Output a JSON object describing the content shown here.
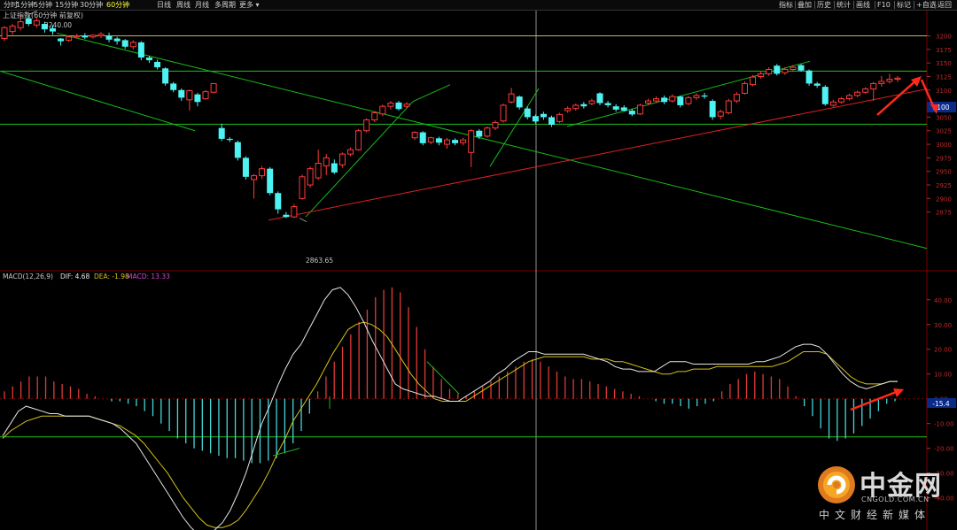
{
  "toolbar": {
    "left_items": [
      "分时",
      "1分钟",
      "5分钟",
      "15分钟",
      "30分钟",
      "60分钟",
      "日线",
      "周线",
      "月线",
      "多周期",
      "更多 ▾"
    ],
    "active": "60分钟",
    "right_items": [
      "指标",
      "叠加",
      "历史",
      "统计",
      "画线",
      "F10",
      "标记",
      "+自选",
      "返回"
    ]
  },
  "colors": {
    "up": "#ff3b3b",
    "down": "#4ef2f2",
    "background": "#000000",
    "grid": "#7a0000",
    "trend_green": "#18b918",
    "trend_red": "#e02020",
    "hline_yellow": "#c8b45a",
    "dif": "#e6e6e6",
    "dea": "#d4c21a",
    "macd_label": "#d24bd2",
    "annotation_red": "#ff2a1a"
  },
  "price_panel": {
    "title": "上证指数(60分钟 前复权)",
    "high_label": "3240.00",
    "low_label": "2863.65",
    "price_tag": "3100"
  },
  "macd_panel": {
    "title": "MACD(12,26,9)",
    "dif_label": "DIF: 4.68",
    "dea_label": "DEA: -1.98",
    "macd_label": "MACD: 13.33",
    "level_tag": "-15.4"
  },
  "chart_data": [
    {
      "type": "candlestick",
      "title": "上证指数(60分钟 前复权)",
      "ylim": [
        2770,
        3240
      ],
      "y_ticks": [
        3200,
        3175,
        3150,
        3125,
        3100,
        3075,
        3050,
        3025,
        3000,
        2975,
        2950,
        2925,
        2900,
        2875
      ],
      "annotations": [
        {
          "text": "3240.00",
          "x": 34,
          "y": 3240
        },
        {
          "text": "2863.65",
          "x": 338,
          "y": 2863.65
        }
      ],
      "horizontal_lines": [
        3200,
        3135,
        3037
      ],
      "trend_lines": [
        {
          "color": "green",
          "from": [
            0,
            3135
          ],
          "to": [
            220,
            3025
          ]
        },
        {
          "color": "green",
          "from": [
            64,
            3205
          ],
          "to": [
            1046,
            2808
          ]
        },
        {
          "color": "green",
          "from": [
            345,
            2866
          ],
          "to": [
            466,
            3079
          ]
        },
        {
          "color": "green",
          "from": [
            466,
            3079
          ],
          "to": [
            508,
            3110
          ]
        },
        {
          "color": "green",
          "from": [
            553,
            2959
          ],
          "to": [
            608,
            3103
          ]
        },
        {
          "color": "green",
          "from": [
            640,
            3033
          ],
          "to": [
            914,
            3153
          ]
        },
        {
          "color": "red",
          "from": [
            303,
            2860
          ],
          "to": [
            1046,
            3102
          ]
        }
      ],
      "candles": [
        {
          "o": 3195,
          "c": 3215,
          "h": 3218,
          "l": 3190
        },
        {
          "o": 3208,
          "c": 3218,
          "h": 3222,
          "l": 3202
        },
        {
          "o": 3215,
          "c": 3226,
          "h": 3240,
          "l": 3210
        },
        {
          "o": 3232,
          "c": 3222,
          "h": 3238,
          "l": 3218
        },
        {
          "o": 3220,
          "c": 3228,
          "h": 3233,
          "l": 3215
        },
        {
          "o": 3222,
          "c": 3212,
          "h": 3226,
          "l": 3206
        },
        {
          "o": 3214,
          "c": 3208,
          "h": 3220,
          "l": 3202
        },
        {
          "o": 3195,
          "c": 3190,
          "h": 3196,
          "l": 3182
        },
        {
          "o": 3192,
          "c": 3198,
          "h": 3201,
          "l": 3189
        },
        {
          "o": 3198,
          "c": 3200,
          "h": 3204,
          "l": 3195
        },
        {
          "o": 3200,
          "c": 3197,
          "h": 3205,
          "l": 3194
        },
        {
          "o": 3198,
          "c": 3201,
          "h": 3203,
          "l": 3195
        },
        {
          "o": 3200,
          "c": 3203,
          "h": 3207,
          "l": 3196
        },
        {
          "o": 3200,
          "c": 3193,
          "h": 3206,
          "l": 3188
        },
        {
          "o": 3195,
          "c": 3190,
          "h": 3198,
          "l": 3184
        },
        {
          "o": 3192,
          "c": 3180,
          "h": 3194,
          "l": 3176
        },
        {
          "o": 3180,
          "c": 3188,
          "h": 3192,
          "l": 3175
        },
        {
          "o": 3188,
          "c": 3160,
          "h": 3190,
          "l": 3155
        },
        {
          "o": 3160,
          "c": 3155,
          "h": 3163,
          "l": 3150
        },
        {
          "o": 3152,
          "c": 3142,
          "h": 3156,
          "l": 3138
        },
        {
          "o": 3140,
          "c": 3112,
          "h": 3142,
          "l": 3108
        },
        {
          "o": 3112,
          "c": 3100,
          "h": 3115,
          "l": 3096
        },
        {
          "o": 3100,
          "c": 3086,
          "h": 3103,
          "l": 3080
        },
        {
          "o": 3082,
          "c": 3099,
          "h": 3101,
          "l": 3062
        },
        {
          "o": 3092,
          "c": 3078,
          "h": 3095,
          "l": 3070
        },
        {
          "o": 3084,
          "c": 3097,
          "h": 3100,
          "l": 3082
        },
        {
          "o": 3096,
          "c": 3112,
          "h": 3113,
          "l": 3094
        },
        {
          "o": 3030,
          "c": 3010,
          "h": 3038,
          "l": 3006
        },
        {
          "o": 3010,
          "c": 3008,
          "h": 3013,
          "l": 3004
        },
        {
          "o": 3004,
          "c": 2975,
          "h": 3007,
          "l": 2970
        },
        {
          "o": 2975,
          "c": 2940,
          "h": 2978,
          "l": 2935
        },
        {
          "o": 2935,
          "c": 2942,
          "h": 2945,
          "l": 2900
        },
        {
          "o": 2942,
          "c": 2955,
          "h": 2960,
          "l": 2936
        },
        {
          "o": 2955,
          "c": 2910,
          "h": 2958,
          "l": 2906
        },
        {
          "o": 2910,
          "c": 2880,
          "h": 2913,
          "l": 2872
        },
        {
          "o": 2870,
          "c": 2866,
          "h": 2875,
          "l": 2864
        },
        {
          "o": 2866,
          "c": 2885,
          "h": 2890,
          "l": 2864
        },
        {
          "o": 2900,
          "c": 2940,
          "h": 2944,
          "l": 2898
        },
        {
          "o": 2925,
          "c": 2955,
          "h": 2959,
          "l": 2920
        },
        {
          "o": 2938,
          "c": 2965,
          "h": 2990,
          "l": 2934
        },
        {
          "o": 2960,
          "c": 2975,
          "h": 2982,
          "l": 2943
        },
        {
          "o": 2965,
          "c": 2948,
          "h": 2972,
          "l": 2945
        },
        {
          "o": 2962,
          "c": 2982,
          "h": 2985,
          "l": 2957
        },
        {
          "o": 2982,
          "c": 2990,
          "h": 2994,
          "l": 2978
        },
        {
          "o": 2990,
          "c": 3025,
          "h": 3028,
          "l": 2988
        },
        {
          "o": 3025,
          "c": 3045,
          "h": 3048,
          "l": 3022
        },
        {
          "o": 3045,
          "c": 3058,
          "h": 3061,
          "l": 3041
        },
        {
          "o": 3056,
          "c": 3070,
          "h": 3073,
          "l": 3052
        },
        {
          "o": 3070,
          "c": 3076,
          "h": 3080,
          "l": 3064
        },
        {
          "o": 3077,
          "c": 3065,
          "h": 3080,
          "l": 3062
        },
        {
          "o": 3070,
          "c": 3074,
          "h": 3078,
          "l": 3066
        },
        {
          "o": 3012,
          "c": 3022,
          "h": 3024,
          "l": 3008
        },
        {
          "o": 3022,
          "c": 3002,
          "h": 3024,
          "l": 2998
        },
        {
          "o": 3004,
          "c": 3012,
          "h": 3014,
          "l": 3000
        },
        {
          "o": 3011,
          "c": 3003,
          "h": 3014,
          "l": 2998
        },
        {
          "o": 3000,
          "c": 3008,
          "h": 3012,
          "l": 2992
        },
        {
          "o": 3008,
          "c": 3002,
          "h": 3011,
          "l": 2998
        },
        {
          "o": 3003,
          "c": 3008,
          "h": 3012,
          "l": 2998
        },
        {
          "o": 2985,
          "c": 3025,
          "h": 3028,
          "l": 2958
        },
        {
          "o": 3025,
          "c": 3014,
          "h": 3028,
          "l": 3010
        },
        {
          "o": 3015,
          "c": 3030,
          "h": 3033,
          "l": 3012
        },
        {
          "o": 3030,
          "c": 3040,
          "h": 3044,
          "l": 3026
        },
        {
          "o": 3043,
          "c": 3072,
          "h": 3075,
          "l": 3040
        },
        {
          "o": 3078,
          "c": 3093,
          "h": 3104,
          "l": 3075
        },
        {
          "o": 3088,
          "c": 3068,
          "h": 3090,
          "l": 3064
        },
        {
          "o": 3066,
          "c": 3050,
          "h": 3070,
          "l": 3046
        },
        {
          "o": 3052,
          "c": 3042,
          "h": 3055,
          "l": 3038
        },
        {
          "o": 3056,
          "c": 3050,
          "h": 3060,
          "l": 3045
        },
        {
          "o": 3050,
          "c": 3036,
          "h": 3053,
          "l": 3032
        },
        {
          "o": 3042,
          "c": 3055,
          "h": 3058,
          "l": 3039
        },
        {
          "o": 3062,
          "c": 3066,
          "h": 3070,
          "l": 3058
        },
        {
          "o": 3066,
          "c": 3072,
          "h": 3075,
          "l": 3062
        },
        {
          "o": 3074,
          "c": 3070,
          "h": 3078,
          "l": 3066
        },
        {
          "o": 3075,
          "c": 3080,
          "h": 3084,
          "l": 3072
        },
        {
          "o": 3094,
          "c": 3076,
          "h": 3096,
          "l": 3072
        },
        {
          "o": 3076,
          "c": 3072,
          "h": 3080,
          "l": 3068
        },
        {
          "o": 3070,
          "c": 3064,
          "h": 3074,
          "l": 3060
        },
        {
          "o": 3068,
          "c": 3062,
          "h": 3072,
          "l": 3060
        },
        {
          "o": 3062,
          "c": 3055,
          "h": 3065,
          "l": 3052
        },
        {
          "o": 3056,
          "c": 3072,
          "h": 3075,
          "l": 3054
        },
        {
          "o": 3076,
          "c": 3080,
          "h": 3084,
          "l": 3072
        },
        {
          "o": 3080,
          "c": 3084,
          "h": 3088,
          "l": 3076
        },
        {
          "o": 3086,
          "c": 3078,
          "h": 3090,
          "l": 3074
        },
        {
          "o": 3080,
          "c": 3088,
          "h": 3092,
          "l": 3077
        },
        {
          "o": 3088,
          "c": 3072,
          "h": 3090,
          "l": 3068
        },
        {
          "o": 3075,
          "c": 3086,
          "h": 3089,
          "l": 3072
        },
        {
          "o": 3086,
          "c": 3090,
          "h": 3094,
          "l": 3082
        },
        {
          "o": 3090,
          "c": 3088,
          "h": 3095,
          "l": 3084
        },
        {
          "o": 3080,
          "c": 3050,
          "h": 3083,
          "l": 3045
        },
        {
          "o": 3052,
          "c": 3060,
          "h": 3064,
          "l": 3046
        },
        {
          "o": 3058,
          "c": 3080,
          "h": 3084,
          "l": 3055
        },
        {
          "o": 3080,
          "c": 3092,
          "h": 3096,
          "l": 3076
        },
        {
          "o": 3094,
          "c": 3112,
          "h": 3116,
          "l": 3092
        },
        {
          "o": 3110,
          "c": 3124,
          "h": 3128,
          "l": 3107
        },
        {
          "o": 3125,
          "c": 3130,
          "h": 3134,
          "l": 3121
        },
        {
          "o": 3130,
          "c": 3138,
          "h": 3142,
          "l": 3126
        },
        {
          "o": 3145,
          "c": 3130,
          "h": 3148,
          "l": 3127
        },
        {
          "o": 3132,
          "c": 3138,
          "h": 3142,
          "l": 3128
        },
        {
          "o": 3138,
          "c": 3142,
          "h": 3146,
          "l": 3134
        },
        {
          "o": 3146,
          "c": 3136,
          "h": 3148,
          "l": 3134
        },
        {
          "o": 3136,
          "c": 3112,
          "h": 3138,
          "l": 3108
        },
        {
          "o": 3112,
          "c": 3108,
          "h": 3115,
          "l": 3104
        },
        {
          "o": 3106,
          "c": 3074,
          "h": 3109,
          "l": 3071
        },
        {
          "o": 3072,
          "c": 3078,
          "h": 3082,
          "l": 3069
        },
        {
          "o": 3078,
          "c": 3084,
          "h": 3087,
          "l": 3075
        },
        {
          "o": 3084,
          "c": 3090,
          "h": 3093,
          "l": 3081
        },
        {
          "o": 3090,
          "c": 3096,
          "h": 3099,
          "l": 3087
        },
        {
          "o": 3096,
          "c": 3102,
          "h": 3105,
          "l": 3093
        },
        {
          "o": 3102,
          "c": 3112,
          "h": 3115,
          "l": 3080
        },
        {
          "o": 3112,
          "c": 3116,
          "h": 3126,
          "l": 3106
        },
        {
          "o": 3116,
          "c": 3120,
          "h": 3130,
          "l": 3112
        },
        {
          "o": 3120,
          "c": 3122,
          "h": 3126,
          "l": 3115
        }
      ]
    },
    {
      "type": "bar+line",
      "title": "MACD(12,26,9)",
      "ylim": [
        -53,
        51
      ],
      "y_ticks": [
        40,
        30,
        20,
        10,
        0,
        -10,
        -20,
        -30,
        -40
      ],
      "horizontal_lines": [
        -15.4
      ],
      "hist": [
        3,
        5,
        7,
        9,
        9,
        9,
        7,
        6,
        5,
        4,
        2,
        1,
        0,
        -1,
        -1,
        -2,
        -3,
        -5,
        -7,
        -10,
        -13,
        -16,
        -18,
        -20,
        -21,
        -22,
        -23,
        -24,
        -24,
        -25,
        -26,
        -26,
        -25,
        -24,
        -22,
        -18,
        -13,
        -6,
        3,
        9,
        15,
        21,
        26,
        31,
        36,
        41,
        44,
        45,
        43,
        37,
        29,
        20,
        13,
        8,
        4,
        2,
        1,
        3,
        5,
        7,
        9,
        11,
        13,
        15,
        16,
        15,
        13,
        11,
        9,
        8,
        8,
        7,
        6,
        5,
        4,
        3,
        2,
        1,
        0,
        -1,
        -2,
        -2,
        -3,
        -4,
        -3,
        -2,
        -1,
        3,
        6,
        8,
        10,
        11,
        10,
        9,
        8,
        5,
        1,
        -3,
        -7,
        -12,
        -16,
        -17,
        -16,
        -14,
        -11,
        -8,
        -5,
        -2,
        -1
      ],
      "dif": [
        -15,
        -10,
        -5,
        -3,
        -4,
        -5,
        -6,
        -6,
        -7,
        -7,
        -7,
        -7,
        -8,
        -9,
        -10,
        -12,
        -15,
        -18,
        -23,
        -28,
        -33,
        -38,
        -43,
        -48,
        -52,
        -55,
        -55,
        -53,
        -50,
        -45,
        -38,
        -30,
        -20,
        -10,
        -3,
        5,
        12,
        18,
        22,
        28,
        34,
        40,
        44,
        45,
        42,
        37,
        31,
        24,
        18,
        12,
        6,
        4,
        3,
        2,
        1,
        1,
        0,
        -1,
        -1,
        1,
        3,
        5,
        7,
        10,
        12,
        15,
        17,
        19,
        19,
        18,
        18,
        18,
        18,
        18,
        18,
        17,
        16,
        15,
        13,
        12,
        12,
        11,
        11,
        11,
        13,
        15,
        15,
        15,
        14,
        14,
        14,
        14,
        14,
        14,
        14,
        14,
        15,
        15,
        16,
        17,
        19,
        21,
        22,
        22,
        21,
        18,
        14,
        10,
        7,
        5,
        4,
        5,
        6,
        7,
        7
      ],
      "dea": [
        -16,
        -13,
        -11,
        -9,
        -8,
        -7,
        -7,
        -7,
        -7,
        -7,
        -7,
        -7,
        -8,
        -9,
        -10,
        -11,
        -13,
        -15,
        -18,
        -22,
        -26,
        -30,
        -35,
        -40,
        -44,
        -48,
        -51,
        -52,
        -52,
        -51,
        -49,
        -45,
        -40,
        -35,
        -29,
        -22,
        -16,
        -9,
        -4,
        1,
        6,
        12,
        18,
        23,
        28,
        30,
        31,
        30,
        28,
        25,
        20,
        15,
        10,
        6,
        3,
        0,
        -1,
        -1,
        -1,
        -1,
        1,
        3,
        5,
        7,
        9,
        11,
        13,
        15,
        16,
        17,
        17,
        17,
        17,
        17,
        17,
        16,
        16,
        16,
        15,
        15,
        14,
        13,
        12,
        11,
        10,
        10,
        11,
        11,
        12,
        12,
        12,
        13,
        13,
        13,
        13,
        13,
        13,
        13,
        13,
        14,
        15,
        17,
        19,
        19,
        19,
        18,
        15,
        12,
        9,
        7,
        6,
        6,
        6,
        7,
        7
      ]
    }
  ]
}
